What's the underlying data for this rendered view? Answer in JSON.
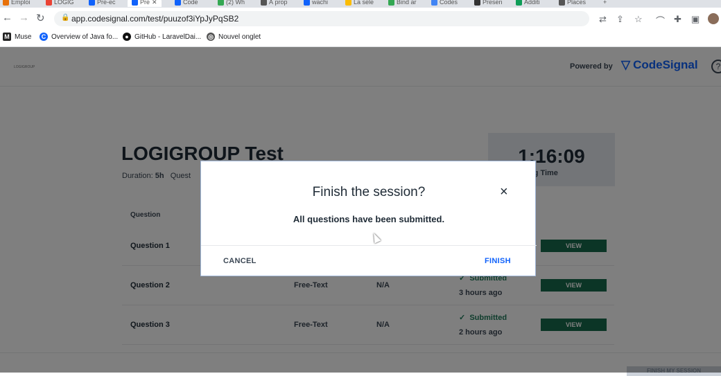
{
  "browser": {
    "tabs": [
      "Emploi",
      "LOGIG",
      "Pre-ec",
      "Pre",
      "Code",
      "(2) Wh",
      "À prop",
      "wachi",
      "La sele",
      "Bind ar",
      "Codes",
      "Presen",
      "Additi",
      "Places"
    ],
    "url": "app.codesignal.com/test/puuzof3iYpJyPqSB2",
    "bookmarks": [
      "Muse",
      "Overview of Java fo...",
      "GitHub - LaravelDai...",
      "Nouvel onglet"
    ]
  },
  "header": {
    "small_logo": "LOGIGROUP",
    "powered_by": "Powered by",
    "brand": "CodeSignal",
    "help": "?"
  },
  "test": {
    "title": "LOGIGROUP Test",
    "duration_label": "Duration:",
    "duration_value": "5h",
    "questions_label": "Quest",
    "timer": "1:16:09",
    "remaining_label": "aining Time"
  },
  "table": {
    "col_question": "Question",
    "rows": [
      {
        "question": "Question 1",
        "type": "",
        "score": "",
        "status": "",
        "time": "",
        "view": "VIEW"
      },
      {
        "question": "Question 2",
        "type": "Free-Text",
        "score": "N/A",
        "status": "Submitted",
        "time": "3 hours ago",
        "view": "VIEW"
      },
      {
        "question": "Question 3",
        "type": "Free-Text",
        "score": "N/A",
        "status": "Submitted",
        "time": "2 hours ago",
        "view": "VIEW"
      }
    ]
  },
  "footer": {
    "finish_all": "FINISH MY SESSION"
  },
  "modal": {
    "title": "Finish the session?",
    "message": "All questions have been submitted.",
    "cancel": "CANCEL",
    "finish": "FINISH",
    "close": "×"
  },
  "colors": {
    "brand_blue": "#1062fb",
    "view_green": "#166b4d",
    "submitted_green": "#1f7a5a"
  }
}
